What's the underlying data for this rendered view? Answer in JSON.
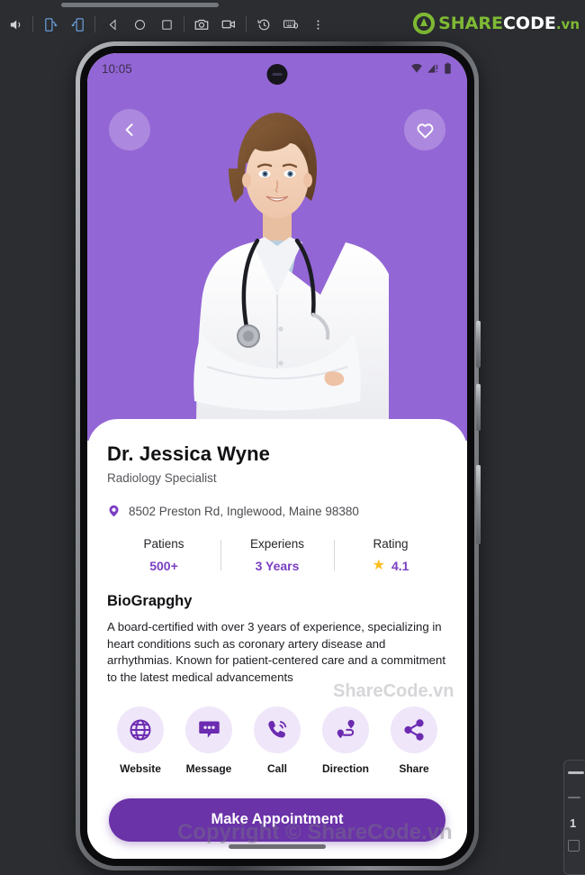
{
  "emulator": {
    "toolbar": {
      "buttons": [
        {
          "name": "volume-icon",
          "label": "Volume"
        },
        {
          "name": "rotate-left-icon",
          "label": "Rotate Left"
        },
        {
          "name": "rotate-right-icon",
          "label": "Rotate Right"
        },
        {
          "name": "back-nav-icon",
          "label": "Back"
        },
        {
          "name": "home-nav-icon",
          "label": "Home"
        },
        {
          "name": "overview-nav-icon",
          "label": "Overview"
        },
        {
          "name": "screenshot-icon",
          "label": "Take Screenshot"
        },
        {
          "name": "record-icon",
          "label": "Record Screen"
        },
        {
          "name": "history-icon",
          "label": "History"
        },
        {
          "name": "keyboard-icon",
          "label": "Keyboard"
        },
        {
          "name": "more-icon",
          "label": "More"
        }
      ]
    },
    "brand": {
      "part1": "SHARE",
      "part2": "CODE",
      "part3": ".vn"
    }
  },
  "watermarks": {
    "center": "ShareCode.vn",
    "copyright": "Copyright © ShareCode.vn"
  },
  "phone": {
    "status_bar": {
      "time": "10:05",
      "icons": [
        "wifi-icon",
        "signal-icon",
        "battery-icon"
      ]
    },
    "hero": {
      "background_color": "#9366D5",
      "back_button": "back-chevron-icon",
      "favorite_button": "heart-outline-icon",
      "photo_alt": "Smiling female doctor in white lab coat with stethoscope, arms crossed"
    },
    "profile": {
      "name": "Dr. Jessica Wyne",
      "specialty": "Radiology Specialist",
      "address": "8502 Preston Rd, Inglewood, Maine 98380",
      "address_icon": "location-pin-icon"
    },
    "stats": [
      {
        "label": "Patiens",
        "value": "500+",
        "type": "text"
      },
      {
        "label": "Experiens",
        "value": "3 Years",
        "type": "text"
      },
      {
        "label": "Rating",
        "value": "4.1",
        "type": "rating",
        "icon": "star-icon"
      }
    ],
    "bio": {
      "title": "BioGrapghy",
      "text": "A board-certified with over 3 years of experience,  specializing in heart conditions such as coronary artery  disease and arrhythmias. Known for patient-centered care  and a commitment to the latest medical advancements"
    },
    "actions": [
      {
        "label": "Website",
        "icon": "globe-www-icon"
      },
      {
        "label": "Message",
        "icon": "chat-bubble-icon"
      },
      {
        "label": "Call",
        "icon": "phone-call-icon"
      },
      {
        "label": "Direction",
        "icon": "route-direction-icon"
      },
      {
        "label": "Share",
        "icon": "share-nodes-icon"
      }
    ],
    "cta": {
      "label": "Make Appointment",
      "color": "#6A33A8"
    },
    "gesture_bar": "home-gesture-bar"
  },
  "side_panel": {
    "number": "1"
  }
}
